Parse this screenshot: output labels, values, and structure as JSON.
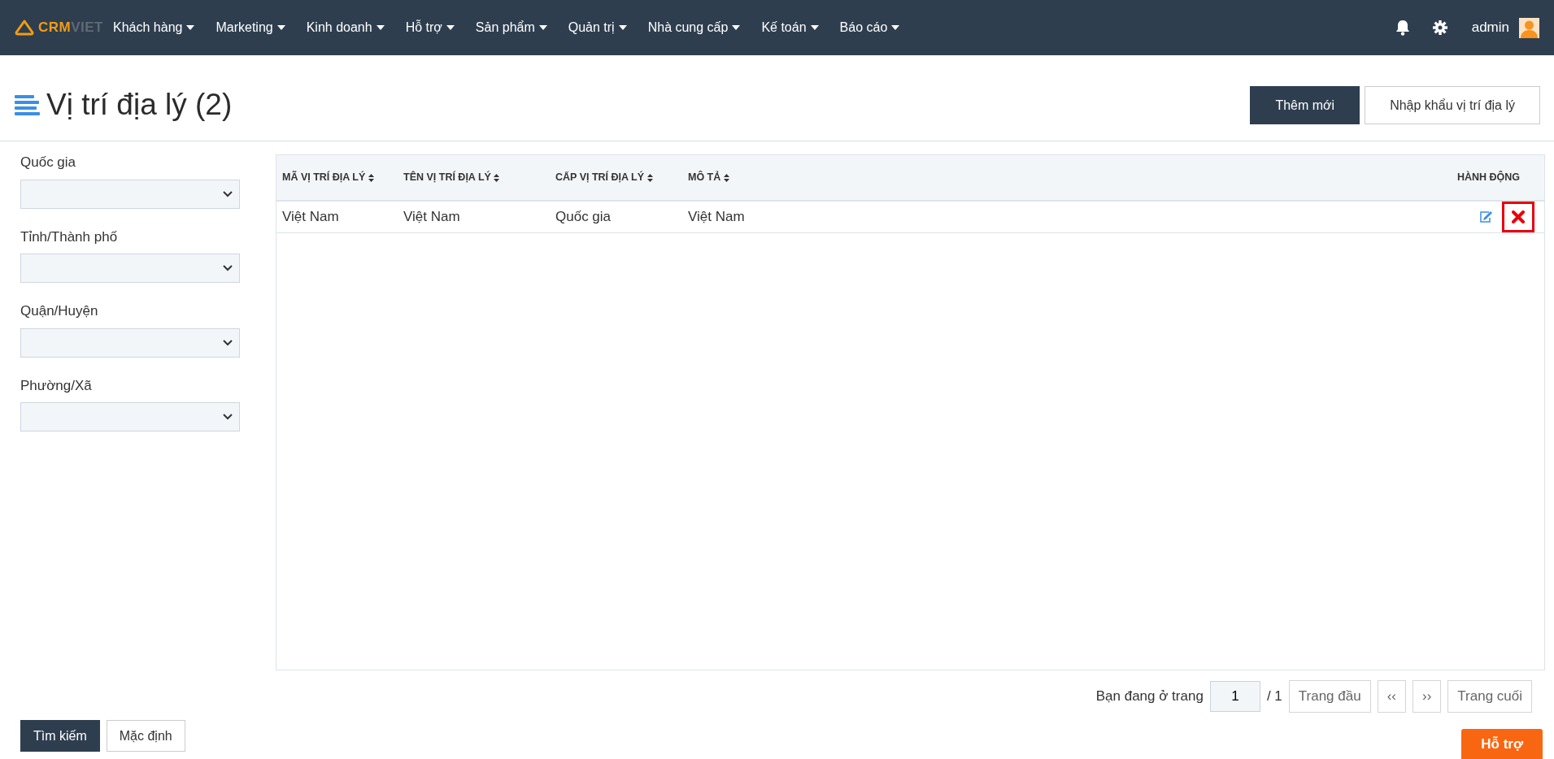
{
  "logo": {
    "text_primary": "CRM",
    "text_secondary": "VIET"
  },
  "menu": [
    {
      "label": "Khách hàng"
    },
    {
      "label": "Marketing"
    },
    {
      "label": "Kinh doanh"
    },
    {
      "label": "Hỗ trợ"
    },
    {
      "label": "Sản phẩm"
    },
    {
      "label": "Quản trị"
    },
    {
      "label": "Nhà cung cấp"
    },
    {
      "label": "Kế toán"
    },
    {
      "label": "Báo cáo"
    }
  ],
  "user": {
    "name": "admin"
  },
  "page": {
    "title": "Vị trí địa lý (2)"
  },
  "header_buttons": [
    {
      "label": "Thêm mới",
      "kind": "primary"
    },
    {
      "label": "Nhập khẩu vị trí địa lý",
      "kind": "outline"
    }
  ],
  "filters": [
    {
      "label": "Quốc gia"
    },
    {
      "label": "Tỉnh/Thành phố"
    },
    {
      "label": "Quận/Huyện"
    },
    {
      "label": "Phường/Xã"
    }
  ],
  "filter_buttons": [
    {
      "label": "Tìm kiếm",
      "kind": "primary"
    },
    {
      "label": "Mặc định",
      "kind": "outline"
    }
  ],
  "table": {
    "columns": [
      {
        "label": "MÃ VỊ TRÍ ĐỊA LÝ",
        "sortable": true
      },
      {
        "label": "TÊN VỊ TRÍ ĐỊA LÝ",
        "sortable": true
      },
      {
        "label": "CẤP VỊ TRÍ ĐỊA LÝ",
        "sortable": true
      },
      {
        "label": "MÔ TẢ",
        "sortable": true
      },
      {
        "label": "HÀNH ĐỘNG",
        "sortable": false
      }
    ],
    "rows": [
      {
        "cells": [
          "Việt Nam",
          "Việt Nam",
          "Quốc gia",
          "Việt Nam"
        ],
        "actions": [
          {
            "kind": "edit",
            "highlighted": false
          },
          {
            "kind": "delete",
            "highlighted": true
          }
        ]
      }
    ]
  },
  "pagination": {
    "prefix": "Bạn đang ở trang",
    "page": "1",
    "total": "/ 1",
    "buttons": [
      "Trang đầu",
      "‹‹",
      "››",
      "Trang cuối"
    ]
  },
  "help_button": {
    "label": "Hỗ trợ"
  }
}
